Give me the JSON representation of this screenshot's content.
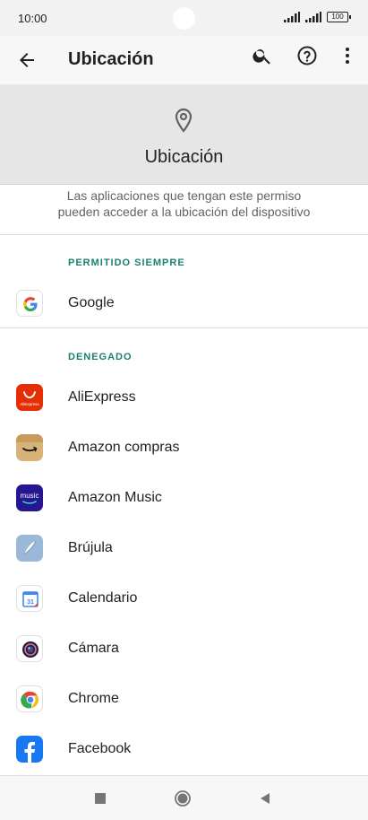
{
  "status": {
    "time": "10:00",
    "battery": "100"
  },
  "appbar": {
    "title": "Ubicación"
  },
  "hero": {
    "heading": "Ubicación"
  },
  "description": {
    "line1": "Las aplicaciones que tengan este permiso",
    "line2": "pueden acceder a la ubicación del dispositivo"
  },
  "sections": {
    "allowed": {
      "header": "PERMITIDO SIEMPRE",
      "apps": [
        "Google"
      ]
    },
    "denied": {
      "header": "DENEGADO",
      "apps": [
        "AliExpress",
        "Amazon compras",
        "Amazon Music",
        "Brújula",
        "Calendario",
        "Cámara",
        "Chrome",
        "Facebook"
      ]
    }
  },
  "icons": {
    "allowed": [
      "google-icon"
    ],
    "denied": [
      "aliexpress-icon",
      "amazon-shopping-icon",
      "amazon-music-icon",
      "compass-icon",
      "calendar-icon",
      "camera-icon",
      "chrome-icon",
      "facebook-icon"
    ]
  },
  "icon_text": {
    "amazon_music": "music",
    "calendar": "31",
    "aliexpress": "AliExpress"
  },
  "colors": {
    "accent": "#1a7f74"
  }
}
